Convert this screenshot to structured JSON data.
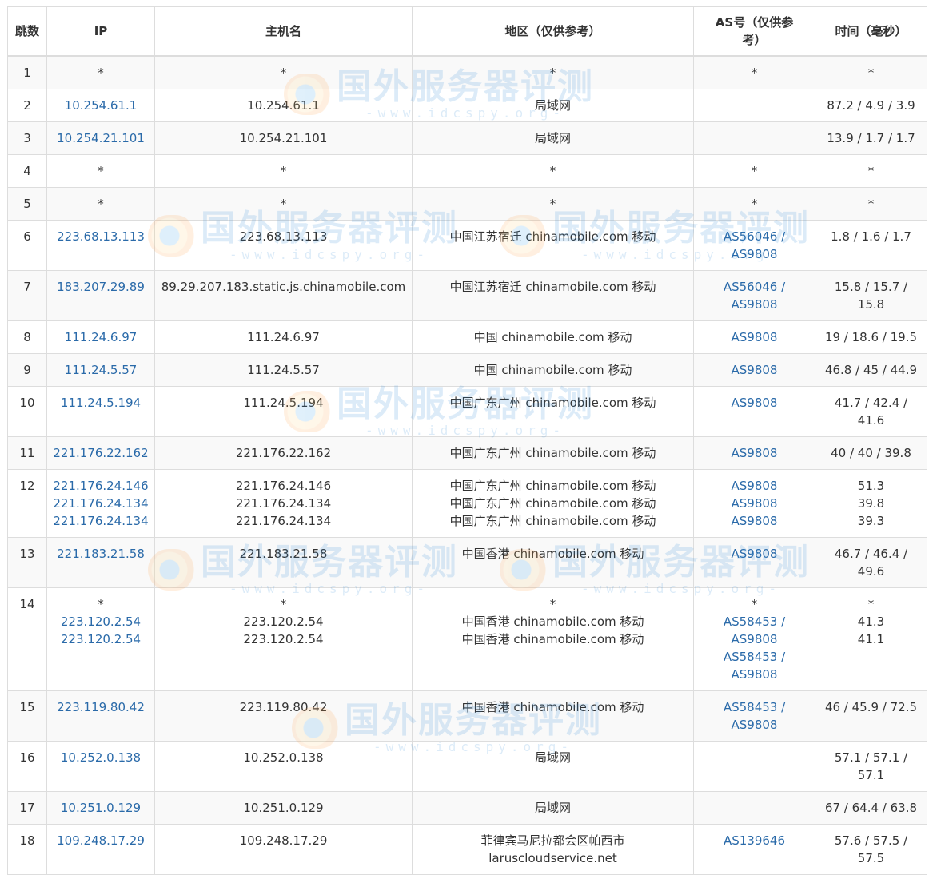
{
  "table": {
    "headers": {
      "hop": "跳数",
      "ip": "IP",
      "host": "主机名",
      "region": "地区（仅供参考）",
      "as": "AS号（仅供参考）",
      "time": "时间（毫秒）"
    },
    "rows": [
      {
        "hop": "1",
        "ip": [
          "*"
        ],
        "host": [
          "*"
        ],
        "region": [
          "*"
        ],
        "as": [
          "*"
        ],
        "time": [
          "*"
        ]
      },
      {
        "hop": "2",
        "ip": [
          "10.254.61.1"
        ],
        "host": [
          "10.254.61.1"
        ],
        "region": [
          "局域网"
        ],
        "as": [],
        "time": [
          "87.2 / 4.9 / 3.9"
        ]
      },
      {
        "hop": "3",
        "ip": [
          "10.254.21.101"
        ],
        "host": [
          "10.254.21.101"
        ],
        "region": [
          "局域网"
        ],
        "as": [],
        "time": [
          "13.9 / 1.7 / 1.7"
        ]
      },
      {
        "hop": "4",
        "ip": [
          "*"
        ],
        "host": [
          "*"
        ],
        "region": [
          "*"
        ],
        "as": [
          "*"
        ],
        "time": [
          "*"
        ]
      },
      {
        "hop": "5",
        "ip": [
          "*"
        ],
        "host": [
          "*"
        ],
        "region": [
          "*"
        ],
        "as": [
          "*"
        ],
        "time": [
          "*"
        ]
      },
      {
        "hop": "6",
        "ip": [
          "223.68.13.113"
        ],
        "host": [
          "223.68.13.113"
        ],
        "region": [
          "中国江苏宿迁 chinamobile.com 移动"
        ],
        "as": [
          "AS56046 /",
          "AS9808"
        ],
        "time": [
          "1.8 / 1.6 / 1.7"
        ]
      },
      {
        "hop": "7",
        "ip": [
          "183.207.29.89"
        ],
        "host": [
          "89.29.207.183.static.js.chinamobile.com"
        ],
        "region": [
          "中国江苏宿迁 chinamobile.com 移动"
        ],
        "as": [
          "AS56046 /",
          "AS9808"
        ],
        "time": [
          "15.8 / 15.7 /",
          "15.8"
        ]
      },
      {
        "hop": "8",
        "ip": [
          "111.24.6.97"
        ],
        "host": [
          "111.24.6.97"
        ],
        "region": [
          "中国 chinamobile.com 移动"
        ],
        "as": [
          "AS9808"
        ],
        "time": [
          "19 / 18.6 / 19.5"
        ]
      },
      {
        "hop": "9",
        "ip": [
          "111.24.5.57"
        ],
        "host": [
          "111.24.5.57"
        ],
        "region": [
          "中国 chinamobile.com 移动"
        ],
        "as": [
          "AS9808"
        ],
        "time": [
          "46.8 / 45 / 44.9"
        ]
      },
      {
        "hop": "10",
        "ip": [
          "111.24.5.194"
        ],
        "host": [
          "111.24.5.194"
        ],
        "region": [
          "中国广东广州 chinamobile.com 移动"
        ],
        "as": [
          "AS9808"
        ],
        "time": [
          "41.7 / 42.4 /",
          "41.6"
        ]
      },
      {
        "hop": "11",
        "ip": [
          "221.176.22.162"
        ],
        "host": [
          "221.176.22.162"
        ],
        "region": [
          "中国广东广州 chinamobile.com 移动"
        ],
        "as": [
          "AS9808"
        ],
        "time": [
          "40 / 40 / 39.8"
        ]
      },
      {
        "hop": "12",
        "ip": [
          "221.176.24.146",
          "221.176.24.134",
          "221.176.24.134"
        ],
        "host": [
          "221.176.24.146",
          "221.176.24.134",
          "221.176.24.134"
        ],
        "region": [
          "中国广东广州 chinamobile.com 移动",
          "中国广东广州 chinamobile.com 移动",
          "中国广东广州 chinamobile.com 移动"
        ],
        "as": [
          "AS9808",
          "AS9808",
          "AS9808"
        ],
        "time": [
          "51.3",
          "39.8",
          "39.3"
        ]
      },
      {
        "hop": "13",
        "ip": [
          "221.183.21.58"
        ],
        "host": [
          "221.183.21.58"
        ],
        "region": [
          "中国香港 chinamobile.com 移动"
        ],
        "as": [
          "AS9808"
        ],
        "time": [
          "46.7 / 46.4 /",
          "49.6"
        ]
      },
      {
        "hop": "14",
        "ip": [
          "*",
          "223.120.2.54",
          "223.120.2.54"
        ],
        "host": [
          "*",
          "223.120.2.54",
          "223.120.2.54"
        ],
        "region": [
          "*",
          "中国香港 chinamobile.com 移动",
          "中国香港 chinamobile.com 移动"
        ],
        "as": [
          "*",
          "AS58453 /",
          "AS9808",
          "AS58453 /",
          "AS9808"
        ],
        "time": [
          "*",
          "41.3",
          "41.1"
        ]
      },
      {
        "hop": "15",
        "ip": [
          "223.119.80.42"
        ],
        "host": [
          "223.119.80.42"
        ],
        "region": [
          "中国香港 chinamobile.com 移动"
        ],
        "as": [
          "AS58453 /",
          "AS9808"
        ],
        "time": [
          "46 / 45.9 / 72.5"
        ]
      },
      {
        "hop": "16",
        "ip": [
          "10.252.0.138"
        ],
        "host": [
          "10.252.0.138"
        ],
        "region": [
          "局域网"
        ],
        "as": [],
        "time": [
          "57.1 / 57.1 /",
          "57.1"
        ]
      },
      {
        "hop": "17",
        "ip": [
          "10.251.0.129"
        ],
        "host": [
          "10.251.0.129"
        ],
        "region": [
          "局域网"
        ],
        "as": [],
        "time": [
          "67 / 64.4 / 63.8"
        ]
      },
      {
        "hop": "18",
        "ip": [
          "109.248.17.29"
        ],
        "host": [
          "109.248.17.29"
        ],
        "region": [
          "菲律宾马尼拉都会区帕西市",
          "laruscloudservice.net"
        ],
        "as": [
          "AS139646"
        ],
        "time": [
          "57.6 / 57.5 /",
          "57.5"
        ]
      }
    ]
  },
  "watermark": {
    "main": "国外服务器评测",
    "sub": "-www.idcspy.org-"
  },
  "colors": {
    "link": "#2a6aa9",
    "text": "#333333",
    "border": "#dddddd",
    "stripe": "#f9f9f9"
  }
}
